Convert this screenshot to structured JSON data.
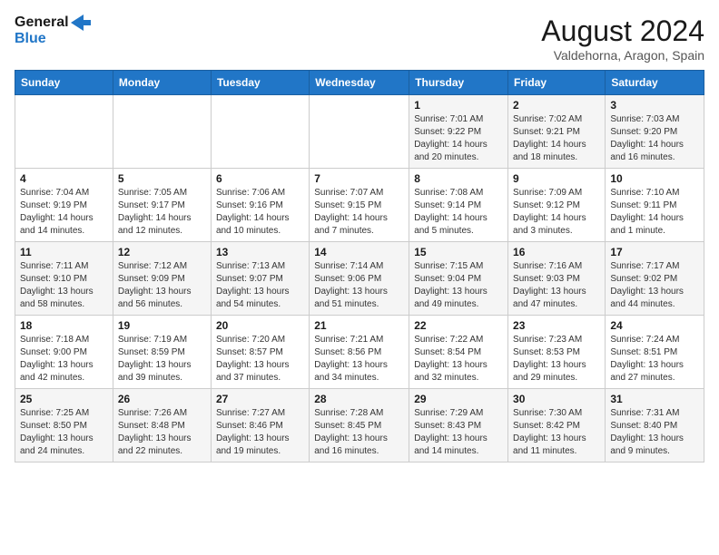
{
  "header": {
    "logo_general": "General",
    "logo_blue": "Blue",
    "main_title": "August 2024",
    "subtitle": "Valdehorna, Aragon, Spain"
  },
  "days_of_week": [
    "Sunday",
    "Monday",
    "Tuesday",
    "Wednesday",
    "Thursday",
    "Friday",
    "Saturday"
  ],
  "weeks": [
    [
      {
        "day": "",
        "info": ""
      },
      {
        "day": "",
        "info": ""
      },
      {
        "day": "",
        "info": ""
      },
      {
        "day": "",
        "info": ""
      },
      {
        "day": "1",
        "info": "Sunrise: 7:01 AM\nSunset: 9:22 PM\nDaylight: 14 hours\nand 20 minutes."
      },
      {
        "day": "2",
        "info": "Sunrise: 7:02 AM\nSunset: 9:21 PM\nDaylight: 14 hours\nand 18 minutes."
      },
      {
        "day": "3",
        "info": "Sunrise: 7:03 AM\nSunset: 9:20 PM\nDaylight: 14 hours\nand 16 minutes."
      }
    ],
    [
      {
        "day": "4",
        "info": "Sunrise: 7:04 AM\nSunset: 9:19 PM\nDaylight: 14 hours\nand 14 minutes."
      },
      {
        "day": "5",
        "info": "Sunrise: 7:05 AM\nSunset: 9:17 PM\nDaylight: 14 hours\nand 12 minutes."
      },
      {
        "day": "6",
        "info": "Sunrise: 7:06 AM\nSunset: 9:16 PM\nDaylight: 14 hours\nand 10 minutes."
      },
      {
        "day": "7",
        "info": "Sunrise: 7:07 AM\nSunset: 9:15 PM\nDaylight: 14 hours\nand 7 minutes."
      },
      {
        "day": "8",
        "info": "Sunrise: 7:08 AM\nSunset: 9:14 PM\nDaylight: 14 hours\nand 5 minutes."
      },
      {
        "day": "9",
        "info": "Sunrise: 7:09 AM\nSunset: 9:12 PM\nDaylight: 14 hours\nand 3 minutes."
      },
      {
        "day": "10",
        "info": "Sunrise: 7:10 AM\nSunset: 9:11 PM\nDaylight: 14 hours\nand 1 minute."
      }
    ],
    [
      {
        "day": "11",
        "info": "Sunrise: 7:11 AM\nSunset: 9:10 PM\nDaylight: 13 hours\nand 58 minutes."
      },
      {
        "day": "12",
        "info": "Sunrise: 7:12 AM\nSunset: 9:09 PM\nDaylight: 13 hours\nand 56 minutes."
      },
      {
        "day": "13",
        "info": "Sunrise: 7:13 AM\nSunset: 9:07 PM\nDaylight: 13 hours\nand 54 minutes."
      },
      {
        "day": "14",
        "info": "Sunrise: 7:14 AM\nSunset: 9:06 PM\nDaylight: 13 hours\nand 51 minutes."
      },
      {
        "day": "15",
        "info": "Sunrise: 7:15 AM\nSunset: 9:04 PM\nDaylight: 13 hours\nand 49 minutes."
      },
      {
        "day": "16",
        "info": "Sunrise: 7:16 AM\nSunset: 9:03 PM\nDaylight: 13 hours\nand 47 minutes."
      },
      {
        "day": "17",
        "info": "Sunrise: 7:17 AM\nSunset: 9:02 PM\nDaylight: 13 hours\nand 44 minutes."
      }
    ],
    [
      {
        "day": "18",
        "info": "Sunrise: 7:18 AM\nSunset: 9:00 PM\nDaylight: 13 hours\nand 42 minutes."
      },
      {
        "day": "19",
        "info": "Sunrise: 7:19 AM\nSunset: 8:59 PM\nDaylight: 13 hours\nand 39 minutes."
      },
      {
        "day": "20",
        "info": "Sunrise: 7:20 AM\nSunset: 8:57 PM\nDaylight: 13 hours\nand 37 minutes."
      },
      {
        "day": "21",
        "info": "Sunrise: 7:21 AM\nSunset: 8:56 PM\nDaylight: 13 hours\nand 34 minutes."
      },
      {
        "day": "22",
        "info": "Sunrise: 7:22 AM\nSunset: 8:54 PM\nDaylight: 13 hours\nand 32 minutes."
      },
      {
        "day": "23",
        "info": "Sunrise: 7:23 AM\nSunset: 8:53 PM\nDaylight: 13 hours\nand 29 minutes."
      },
      {
        "day": "24",
        "info": "Sunrise: 7:24 AM\nSunset: 8:51 PM\nDaylight: 13 hours\nand 27 minutes."
      }
    ],
    [
      {
        "day": "25",
        "info": "Sunrise: 7:25 AM\nSunset: 8:50 PM\nDaylight: 13 hours\nand 24 minutes."
      },
      {
        "day": "26",
        "info": "Sunrise: 7:26 AM\nSunset: 8:48 PM\nDaylight: 13 hours\nand 22 minutes."
      },
      {
        "day": "27",
        "info": "Sunrise: 7:27 AM\nSunset: 8:46 PM\nDaylight: 13 hours\nand 19 minutes."
      },
      {
        "day": "28",
        "info": "Sunrise: 7:28 AM\nSunset: 8:45 PM\nDaylight: 13 hours\nand 16 minutes."
      },
      {
        "day": "29",
        "info": "Sunrise: 7:29 AM\nSunset: 8:43 PM\nDaylight: 13 hours\nand 14 minutes."
      },
      {
        "day": "30",
        "info": "Sunrise: 7:30 AM\nSunset: 8:42 PM\nDaylight: 13 hours\nand 11 minutes."
      },
      {
        "day": "31",
        "info": "Sunrise: 7:31 AM\nSunset: 8:40 PM\nDaylight: 13 hours\nand 9 minutes."
      }
    ]
  ]
}
